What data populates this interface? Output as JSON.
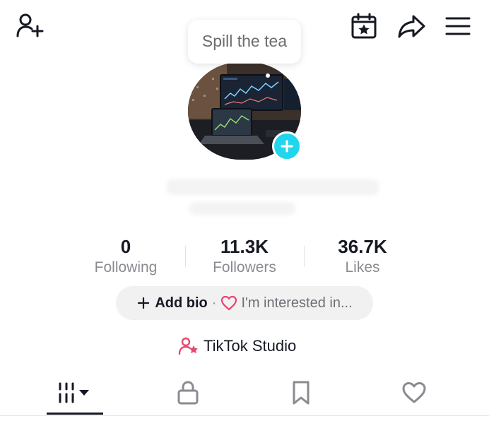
{
  "header": {
    "add_friend_icon": "person-plus-icon",
    "calendar_icon": "calendar-star-icon",
    "share_icon": "share-arrow-icon",
    "menu_icon": "hamburger-menu-icon"
  },
  "tooltip": {
    "text": "Spill the tea"
  },
  "avatar": {
    "add_icon": "plus-icon",
    "accent": "#20d5ec"
  },
  "stats": [
    {
      "value": "0",
      "label": "Following"
    },
    {
      "value": "11.3K",
      "label": "Followers"
    },
    {
      "value": "36.7K",
      "label": "Likes"
    }
  ],
  "bio": {
    "add_label": "Add bio",
    "separator": "·",
    "interest_label": "I'm interested in..."
  },
  "studio": {
    "label": "TikTok Studio",
    "icon": "person-star-icon",
    "icon_color": "#e8466f"
  },
  "tabs": [
    {
      "name": "videos",
      "icon": "grid-bars-icon",
      "active": true
    },
    {
      "name": "private",
      "icon": "lock-icon",
      "active": false
    },
    {
      "name": "favorites",
      "icon": "bookmark-icon",
      "active": false
    },
    {
      "name": "liked",
      "icon": "heart-icon",
      "active": false
    }
  ]
}
